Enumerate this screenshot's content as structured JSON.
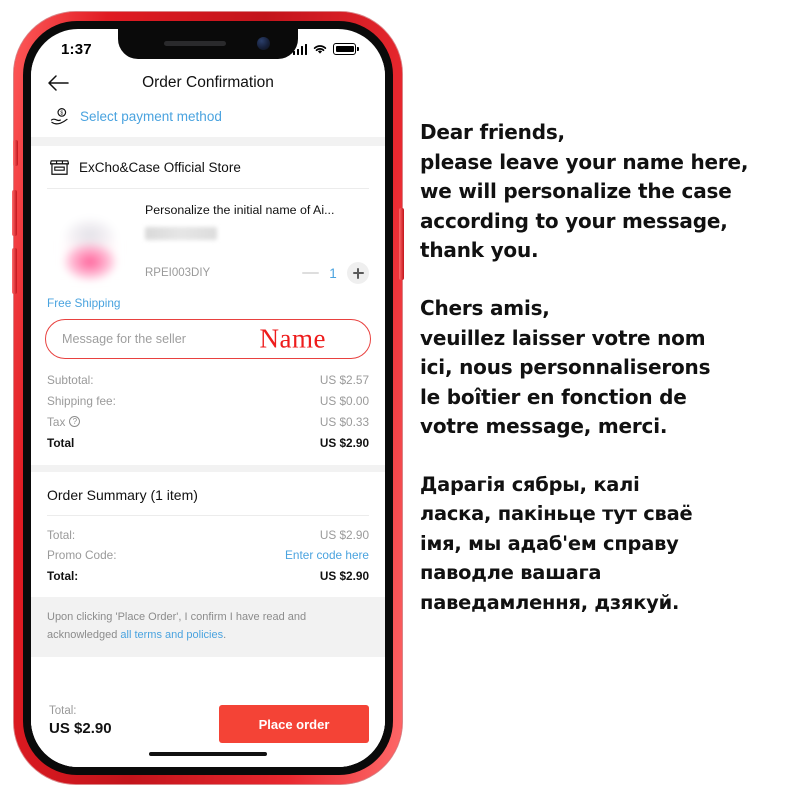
{
  "phone": {
    "status_bar": {
      "time": "1:37",
      "signal_icon": "cellular-bars-icon",
      "wifi_icon": "wifi-icon",
      "battery_icon": "battery-full-icon"
    },
    "navbar": {
      "back_icon": "back-arrow-icon",
      "title": "Order Confirmation"
    },
    "payment": {
      "icon": "hand-holding-coin-icon",
      "label": "Select payment method"
    },
    "store": {
      "icon": "storefront-icon",
      "name": "ExCho&Case Official Store"
    },
    "product": {
      "title": "Personalize the initial name of Ai...",
      "sku": "RPEI003DIY",
      "quantity": "1",
      "minus_icon": "minus-icon",
      "plus_icon": "plus-icon",
      "shipping_label": "Free Shipping"
    },
    "message_field": {
      "placeholder": "Message for the seller",
      "annotation": "Name",
      "annotation_color": "#ee1c1c",
      "border_color": "#e8413f"
    },
    "price_rows": [
      {
        "label": "Subtotal:",
        "value": "US $2.57",
        "strong": false,
        "help_icon": false
      },
      {
        "label": "Shipping fee:",
        "value": "US $0.00",
        "strong": false,
        "help_icon": false
      },
      {
        "label": "Tax",
        "value": "US $0.33",
        "strong": false,
        "help_icon": true
      },
      {
        "label": "Total",
        "value": "US $2.90",
        "strong": true,
        "help_icon": false
      }
    ],
    "order_summary": {
      "heading": "Order Summary (1 item)",
      "rows": [
        {
          "label": "Total:",
          "value": "US $2.90",
          "strong": false,
          "link": false
        },
        {
          "label": "Promo Code:",
          "value": "Enter code here",
          "strong": false,
          "link": true
        },
        {
          "label": "Total:",
          "value": "US $2.90",
          "strong": true,
          "link": false
        }
      ]
    },
    "terms": {
      "text_before": "Upon clicking 'Place Order', I confirm I have read and acknowledged ",
      "link_text": "all terms and policies",
      "text_after": "."
    },
    "bottom_bar": {
      "total_label": "Total:",
      "total_value": "US $2.90",
      "place_order_label": "Place order",
      "button_color": "#f44336"
    }
  },
  "notes": {
    "blocks": [
      {
        "lang": "en",
        "lines": [
          "Dear friends,",
          "please leave your name here,",
          "we will personalize the case",
          "according to your message,",
          "thank you."
        ]
      },
      {
        "lang": "fr",
        "lines": [
          "Chers amis,",
          "veuillez laisser votre nom",
          "ici, nous personnaliserons",
          "le boîtier en fonction de",
          "votre message, merci."
        ]
      },
      {
        "lang": "be",
        "lines": [
          "Дарагія сябры, калі",
          "ласка, пакіньце тут сваё",
          "імя, мы адаб'ем справу",
          "паводле вашага",
          "паведамлення, дзякуй."
        ]
      }
    ]
  }
}
